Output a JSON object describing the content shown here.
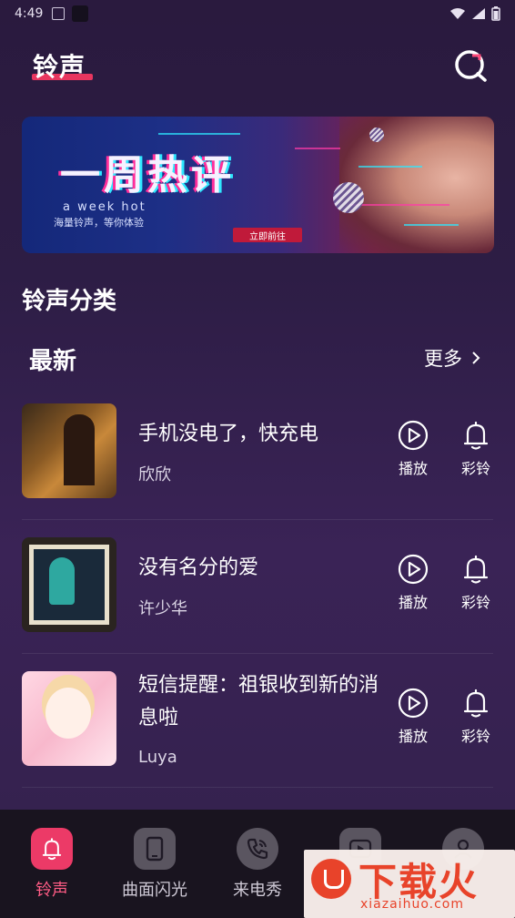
{
  "status_bar": {
    "time": "4:49"
  },
  "header": {
    "title": "铃声"
  },
  "banner": {
    "title": "一周热评",
    "subtitle_en": "a week hot",
    "subtitle_cn": "海量铃声，等你体验",
    "button_label": "立即前往"
  },
  "category": {
    "title": "铃声分类"
  },
  "section": {
    "title": "最新",
    "more_label": "更多"
  },
  "songs": [
    {
      "name": "手机没电了，快充电",
      "artist": "欣欣",
      "play_label": "播放",
      "ring_label": "彩铃"
    },
    {
      "name": "没有名分的爱",
      "artist": "许少华",
      "play_label": "播放",
      "ring_label": "彩铃"
    },
    {
      "name": "短信提醒：祖银收到新的消息啦",
      "artist": "Luya",
      "play_label": "播放",
      "ring_label": "彩铃"
    }
  ],
  "bottom_nav": [
    {
      "label": "铃声",
      "icon": "bell-icon",
      "active": true
    },
    {
      "label": "曲面闪光",
      "icon": "phone-icon",
      "active": false
    },
    {
      "label": "来电秀",
      "icon": "call-icon",
      "active": false
    },
    {
      "label": "",
      "icon": "video-icon",
      "active": false
    },
    {
      "label": "",
      "icon": "user-icon",
      "active": false
    }
  ],
  "watermark": {
    "title": "下载火",
    "url": "xiazaihuo.com"
  },
  "colors": {
    "accent": "#e8365f",
    "nav_active": "#ec3a67",
    "nav_bg": "#19141f"
  }
}
